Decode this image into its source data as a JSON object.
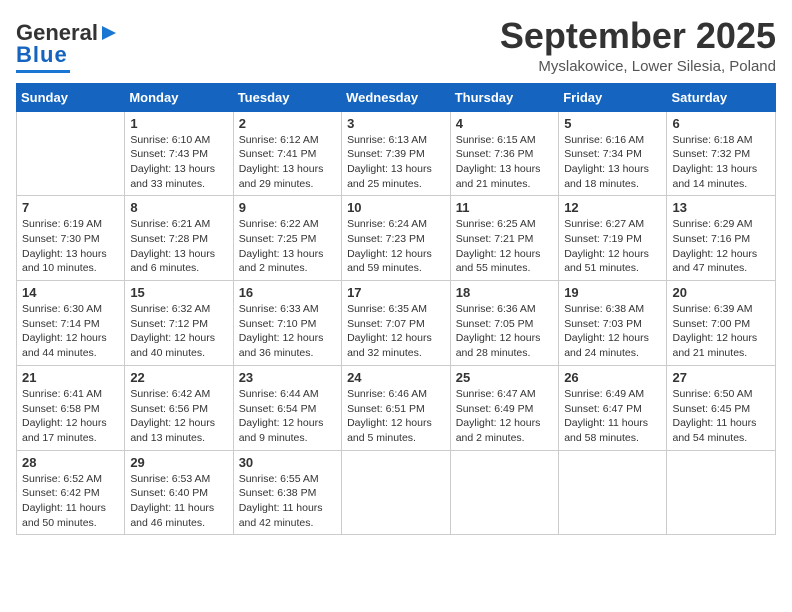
{
  "header": {
    "logo_general": "General",
    "logo_blue": "Blue",
    "month_title": "September 2025",
    "location": "Myslakowice, Lower Silesia, Poland"
  },
  "days_of_week": [
    "Sunday",
    "Monday",
    "Tuesday",
    "Wednesday",
    "Thursday",
    "Friday",
    "Saturday"
  ],
  "weeks": [
    [
      {
        "day": "",
        "info": ""
      },
      {
        "day": "1",
        "info": "Sunrise: 6:10 AM\nSunset: 7:43 PM\nDaylight: 13 hours\nand 33 minutes."
      },
      {
        "day": "2",
        "info": "Sunrise: 6:12 AM\nSunset: 7:41 PM\nDaylight: 13 hours\nand 29 minutes."
      },
      {
        "day": "3",
        "info": "Sunrise: 6:13 AM\nSunset: 7:39 PM\nDaylight: 13 hours\nand 25 minutes."
      },
      {
        "day": "4",
        "info": "Sunrise: 6:15 AM\nSunset: 7:36 PM\nDaylight: 13 hours\nand 21 minutes."
      },
      {
        "day": "5",
        "info": "Sunrise: 6:16 AM\nSunset: 7:34 PM\nDaylight: 13 hours\nand 18 minutes."
      },
      {
        "day": "6",
        "info": "Sunrise: 6:18 AM\nSunset: 7:32 PM\nDaylight: 13 hours\nand 14 minutes."
      }
    ],
    [
      {
        "day": "7",
        "info": "Sunrise: 6:19 AM\nSunset: 7:30 PM\nDaylight: 13 hours\nand 10 minutes."
      },
      {
        "day": "8",
        "info": "Sunrise: 6:21 AM\nSunset: 7:28 PM\nDaylight: 13 hours\nand 6 minutes."
      },
      {
        "day": "9",
        "info": "Sunrise: 6:22 AM\nSunset: 7:25 PM\nDaylight: 13 hours\nand 2 minutes."
      },
      {
        "day": "10",
        "info": "Sunrise: 6:24 AM\nSunset: 7:23 PM\nDaylight: 12 hours\nand 59 minutes."
      },
      {
        "day": "11",
        "info": "Sunrise: 6:25 AM\nSunset: 7:21 PM\nDaylight: 12 hours\nand 55 minutes."
      },
      {
        "day": "12",
        "info": "Sunrise: 6:27 AM\nSunset: 7:19 PM\nDaylight: 12 hours\nand 51 minutes."
      },
      {
        "day": "13",
        "info": "Sunrise: 6:29 AM\nSunset: 7:16 PM\nDaylight: 12 hours\nand 47 minutes."
      }
    ],
    [
      {
        "day": "14",
        "info": "Sunrise: 6:30 AM\nSunset: 7:14 PM\nDaylight: 12 hours\nand 44 minutes."
      },
      {
        "day": "15",
        "info": "Sunrise: 6:32 AM\nSunset: 7:12 PM\nDaylight: 12 hours\nand 40 minutes."
      },
      {
        "day": "16",
        "info": "Sunrise: 6:33 AM\nSunset: 7:10 PM\nDaylight: 12 hours\nand 36 minutes."
      },
      {
        "day": "17",
        "info": "Sunrise: 6:35 AM\nSunset: 7:07 PM\nDaylight: 12 hours\nand 32 minutes."
      },
      {
        "day": "18",
        "info": "Sunrise: 6:36 AM\nSunset: 7:05 PM\nDaylight: 12 hours\nand 28 minutes."
      },
      {
        "day": "19",
        "info": "Sunrise: 6:38 AM\nSunset: 7:03 PM\nDaylight: 12 hours\nand 24 minutes."
      },
      {
        "day": "20",
        "info": "Sunrise: 6:39 AM\nSunset: 7:00 PM\nDaylight: 12 hours\nand 21 minutes."
      }
    ],
    [
      {
        "day": "21",
        "info": "Sunrise: 6:41 AM\nSunset: 6:58 PM\nDaylight: 12 hours\nand 17 minutes."
      },
      {
        "day": "22",
        "info": "Sunrise: 6:42 AM\nSunset: 6:56 PM\nDaylight: 12 hours\nand 13 minutes."
      },
      {
        "day": "23",
        "info": "Sunrise: 6:44 AM\nSunset: 6:54 PM\nDaylight: 12 hours\nand 9 minutes."
      },
      {
        "day": "24",
        "info": "Sunrise: 6:46 AM\nSunset: 6:51 PM\nDaylight: 12 hours\nand 5 minutes."
      },
      {
        "day": "25",
        "info": "Sunrise: 6:47 AM\nSunset: 6:49 PM\nDaylight: 12 hours\nand 2 minutes."
      },
      {
        "day": "26",
        "info": "Sunrise: 6:49 AM\nSunset: 6:47 PM\nDaylight: 11 hours\nand 58 minutes."
      },
      {
        "day": "27",
        "info": "Sunrise: 6:50 AM\nSunset: 6:45 PM\nDaylight: 11 hours\nand 54 minutes."
      }
    ],
    [
      {
        "day": "28",
        "info": "Sunrise: 6:52 AM\nSunset: 6:42 PM\nDaylight: 11 hours\nand 50 minutes."
      },
      {
        "day": "29",
        "info": "Sunrise: 6:53 AM\nSunset: 6:40 PM\nDaylight: 11 hours\nand 46 minutes."
      },
      {
        "day": "30",
        "info": "Sunrise: 6:55 AM\nSunset: 6:38 PM\nDaylight: 11 hours\nand 42 minutes."
      },
      {
        "day": "",
        "info": ""
      },
      {
        "day": "",
        "info": ""
      },
      {
        "day": "",
        "info": ""
      },
      {
        "day": "",
        "info": ""
      }
    ]
  ]
}
